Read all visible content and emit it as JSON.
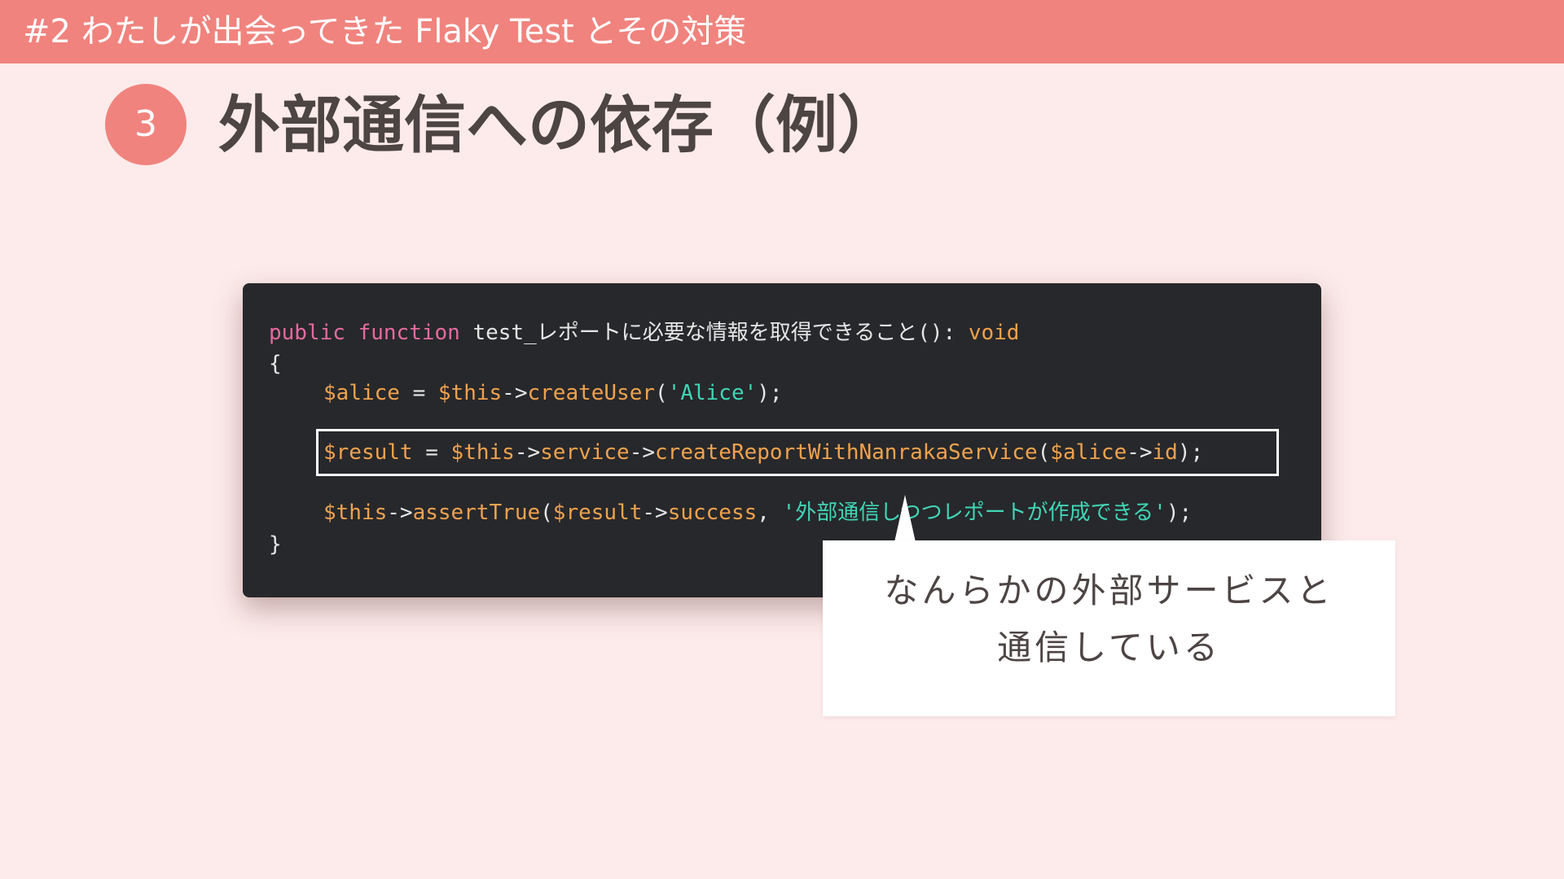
{
  "header": {
    "title": "#2 わたしが出会ってきた Flaky Test とその対策"
  },
  "slide": {
    "number": "3",
    "title": "外部通信への依存（例）"
  },
  "code": {
    "line1": {
      "kw_public": "public",
      "kw_function": "function",
      "name": "test_レポートに必要な情報を取得できること(): ",
      "kw_void": "void"
    },
    "line2": {
      "brace": "{"
    },
    "line3": {
      "var_alice": "$alice",
      "eq": " = ",
      "var_this": "$this",
      "arrow": "->",
      "method": "createUser",
      "open": "(",
      "str": "'Alice'",
      "close": ");"
    },
    "line4": {
      "var_result": "$result",
      "eq": " = ",
      "var_this": "$this",
      "arrow1": "->",
      "prop_service": "service",
      "arrow2": "->",
      "method": "createReportWithNanrakaService",
      "open": "(",
      "var_alice": "$alice",
      "arrow3": "->",
      "prop_id": "id",
      "close": ");"
    },
    "line5": {
      "var_this": "$this",
      "arrow1": "->",
      "method": "assertTrue",
      "open": "(",
      "var_result": "$result",
      "arrow2": "->",
      "prop_success": "success",
      "comma": ", ",
      "str": "'外部通信しつつレポートが作成できる'",
      "close": ");"
    },
    "line6": {
      "brace": "}"
    }
  },
  "callout": {
    "line1": "なんらかの外部サービスと",
    "line2": "通信している"
  },
  "colors": {
    "header_bg": "#f0837e",
    "page_bg": "#fcebea",
    "code_bg": "#27282b",
    "keyword": "#e56aa0",
    "variable": "#f0a24d",
    "string": "#3fd7b6",
    "text_dark": "#4d4444"
  }
}
